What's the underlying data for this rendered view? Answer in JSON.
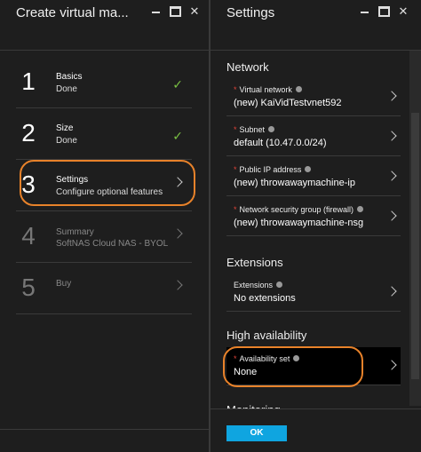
{
  "left_blade": {
    "title": "Create virtual ma...",
    "steps": [
      {
        "number": "1",
        "title": "Basics",
        "subtitle": "Done",
        "status": "done"
      },
      {
        "number": "2",
        "title": "Size",
        "subtitle": "Done",
        "status": "done"
      },
      {
        "number": "3",
        "title": "Settings",
        "subtitle": "Configure optional features",
        "status": "active"
      },
      {
        "number": "4",
        "title": "Summary",
        "subtitle": "SoftNAS Cloud NAS - BYOL",
        "status": "disabled"
      },
      {
        "number": "5",
        "title": "Buy",
        "subtitle": "",
        "status": "disabled"
      }
    ]
  },
  "right_blade": {
    "title": "Settings",
    "sections": {
      "network": {
        "title": "Network",
        "fields": [
          {
            "label": "Virtual network",
            "value": "(new) KaiVidTestvnet592",
            "required": true
          },
          {
            "label": "Subnet",
            "value": "default (10.47.0.0/24)",
            "required": true
          },
          {
            "label": "Public IP address",
            "value": "(new) throwawaymachine-ip",
            "required": true
          },
          {
            "label": "Network security group (firewall)",
            "value": "(new) throwawaymachine-nsg",
            "required": true
          }
        ]
      },
      "extensions": {
        "title": "Extensions",
        "fields": [
          {
            "label": "Extensions",
            "value": "No extensions",
            "required": false
          }
        ]
      },
      "high_availability": {
        "title": "High availability",
        "fields": [
          {
            "label": "Availability set",
            "value": "None",
            "required": true
          }
        ]
      },
      "monitoring": {
        "title": "Monitoring"
      }
    },
    "ok_label": "OK"
  },
  "colors": {
    "background": "#1e1e1e",
    "accent_blue": "#0fa5e0",
    "highlight_orange": "#e8822a",
    "check_green": "#7ac143",
    "required_red": "#e0443a"
  },
  "req_marker": "*"
}
